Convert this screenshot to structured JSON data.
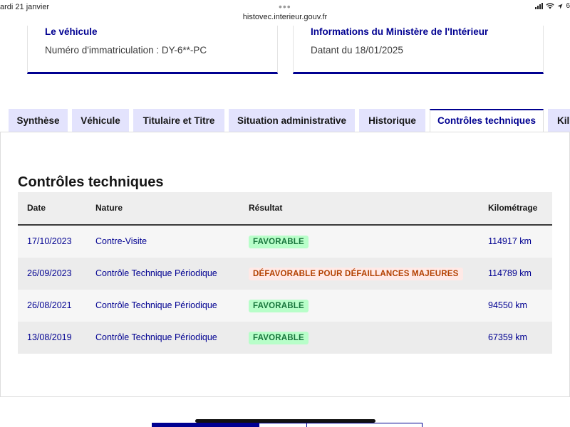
{
  "statusbar": {
    "date": "ardi 21 janvier",
    "url": "histovec.interieur.gouv.fr",
    "dots": "•••",
    "battery_text": "6"
  },
  "vehicle_card": {
    "title": "Le véhicule",
    "text": "Numéro d'immatriculation : DY-6**-PC"
  },
  "ministry_card": {
    "title": "Informations du Ministère de l'Intérieur",
    "text": "Datant du 18/01/2025"
  },
  "tabs": [
    {
      "label": "Synthèse",
      "active": false
    },
    {
      "label": "Véhicule",
      "active": false
    },
    {
      "label": "Titulaire et Titre",
      "active": false
    },
    {
      "label": "Situation administrative",
      "active": false
    },
    {
      "label": "Historique",
      "active": false
    },
    {
      "label": "Contrôles techniques",
      "active": true
    },
    {
      "label": "Kil",
      "active": false
    }
  ],
  "section": {
    "title": "Contrôles techniques"
  },
  "table": {
    "headers": {
      "date": "Date",
      "nature": "Nature",
      "result": "Résultat",
      "km": "Kilométrage"
    },
    "rows": [
      {
        "date": "17/10/2023",
        "nature": "Contre-Visite",
        "result": "FAVORABLE",
        "status": "ok",
        "km": "114917 km"
      },
      {
        "date": "26/09/2023",
        "nature": "Contrôle Technique Périodique",
        "result": "DÉFAVORABLE POUR DÉFAILLANCES MAJEURES",
        "status": "ko",
        "km": "114789 km"
      },
      {
        "date": "26/08/2021",
        "nature": "Contrôle Technique Périodique",
        "result": "FAVORABLE",
        "status": "ok",
        "km": "94550 km"
      },
      {
        "date": "13/08/2019",
        "nature": "Contrôle Technique Périodique",
        "result": "FAVORABLE",
        "status": "ok",
        "km": "67359 km"
      }
    ]
  },
  "colors": {
    "primary": "#000091",
    "tab_bg": "#e3e3fd",
    "success_bg": "#b8fec9",
    "success_text": "#18753c",
    "error_bg": "#ffe9e6",
    "error_text": "#b34000"
  }
}
